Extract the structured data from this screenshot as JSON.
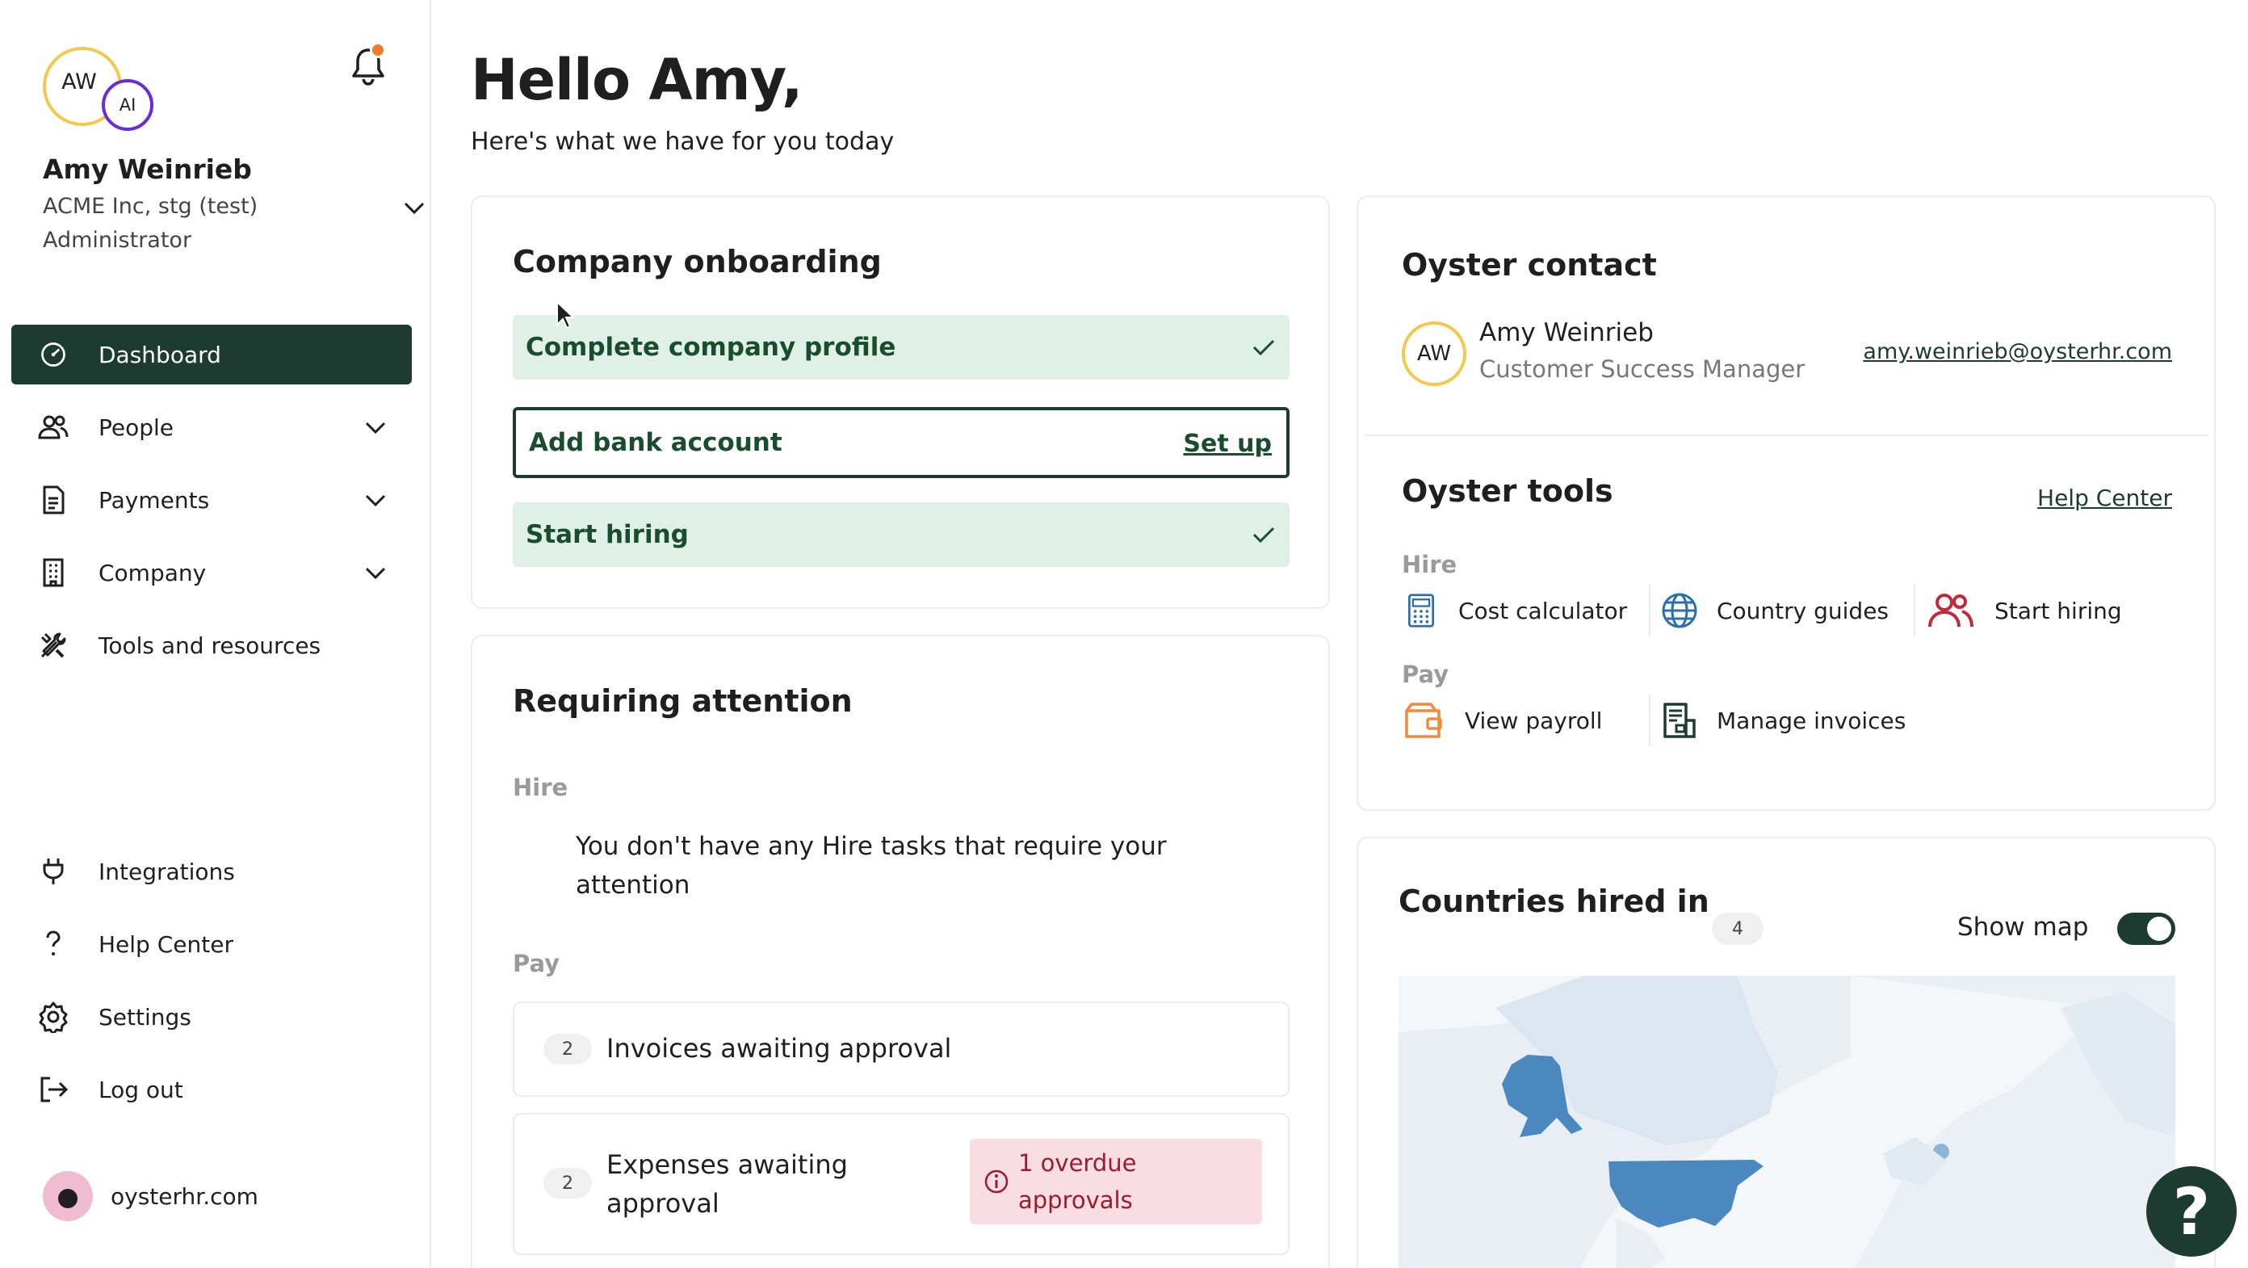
{
  "user": {
    "initials": "AW",
    "secondary_initials": "AI",
    "name": "Amy Weinrieb",
    "company": "ACME Inc, stg (test)",
    "role": "Administrator"
  },
  "nav": {
    "items": [
      {
        "label": "Dashboard",
        "icon": "dashboard-gauge-icon",
        "active": true
      },
      {
        "label": "People",
        "icon": "people-icon"
      },
      {
        "label": "Payments",
        "icon": "payments-document-icon"
      },
      {
        "label": "Company",
        "icon": "building-icon"
      },
      {
        "label": "Tools and resources",
        "icon": "tools-icon"
      }
    ],
    "bottom": [
      {
        "label": "Integrations",
        "icon": "plug-icon"
      },
      {
        "label": "Help Center",
        "icon": "question-icon"
      },
      {
        "label": "Settings",
        "icon": "gear-icon"
      },
      {
        "label": "Log out",
        "icon": "logout-icon"
      }
    ],
    "site": "oysterhr.com"
  },
  "main": {
    "greeting": "Hello Amy,",
    "subtitle": "Here's what we have for you today"
  },
  "onboarding": {
    "title": "Company onboarding",
    "steps": [
      {
        "label": "Complete company profile",
        "status": "done"
      },
      {
        "label": "Add bank account",
        "status": "todo",
        "action": "Set up"
      },
      {
        "label": "Start hiring",
        "status": "done"
      }
    ]
  },
  "attention": {
    "title": "Requiring attention",
    "hire_label": "Hire",
    "hire_empty": "You don't have any Hire tasks that require your attention",
    "pay_label": "Pay",
    "tasks": [
      {
        "count": "2",
        "label": "Invoices awaiting approval"
      },
      {
        "count": "2",
        "label": "Expenses awaiting approval",
        "alert": "1 overdue approvals"
      }
    ]
  },
  "contact": {
    "title": "Oyster contact",
    "initials": "AW",
    "name": "Amy Weinrieb",
    "role": "Customer Success Manager",
    "email": "amy.weinrieb@oysterhr.com"
  },
  "tools": {
    "title": "Oyster tools",
    "help_link": "Help Center",
    "hire_label": "Hire",
    "hire_tools": [
      "Cost calculator",
      "Country guides",
      "Start hiring"
    ],
    "pay_label": "Pay",
    "pay_tools": [
      "View payroll",
      "Manage invoices"
    ]
  },
  "countries": {
    "title": "Countries hired in",
    "count": "4",
    "toggle_label": "Show map",
    "toggle_on": true
  },
  "colors": {
    "primary": "#1d3b30",
    "success_bg": "#dff0e6",
    "success_text": "#1a4d2e",
    "alert_bg": "#f8dde2",
    "alert_text": "#9b1c31",
    "map_highlight": "#4a88bf",
    "map_base": "#dbe6f0",
    "avatar_ring": "#f2c94c",
    "notification_dot": "#f07b2d"
  }
}
